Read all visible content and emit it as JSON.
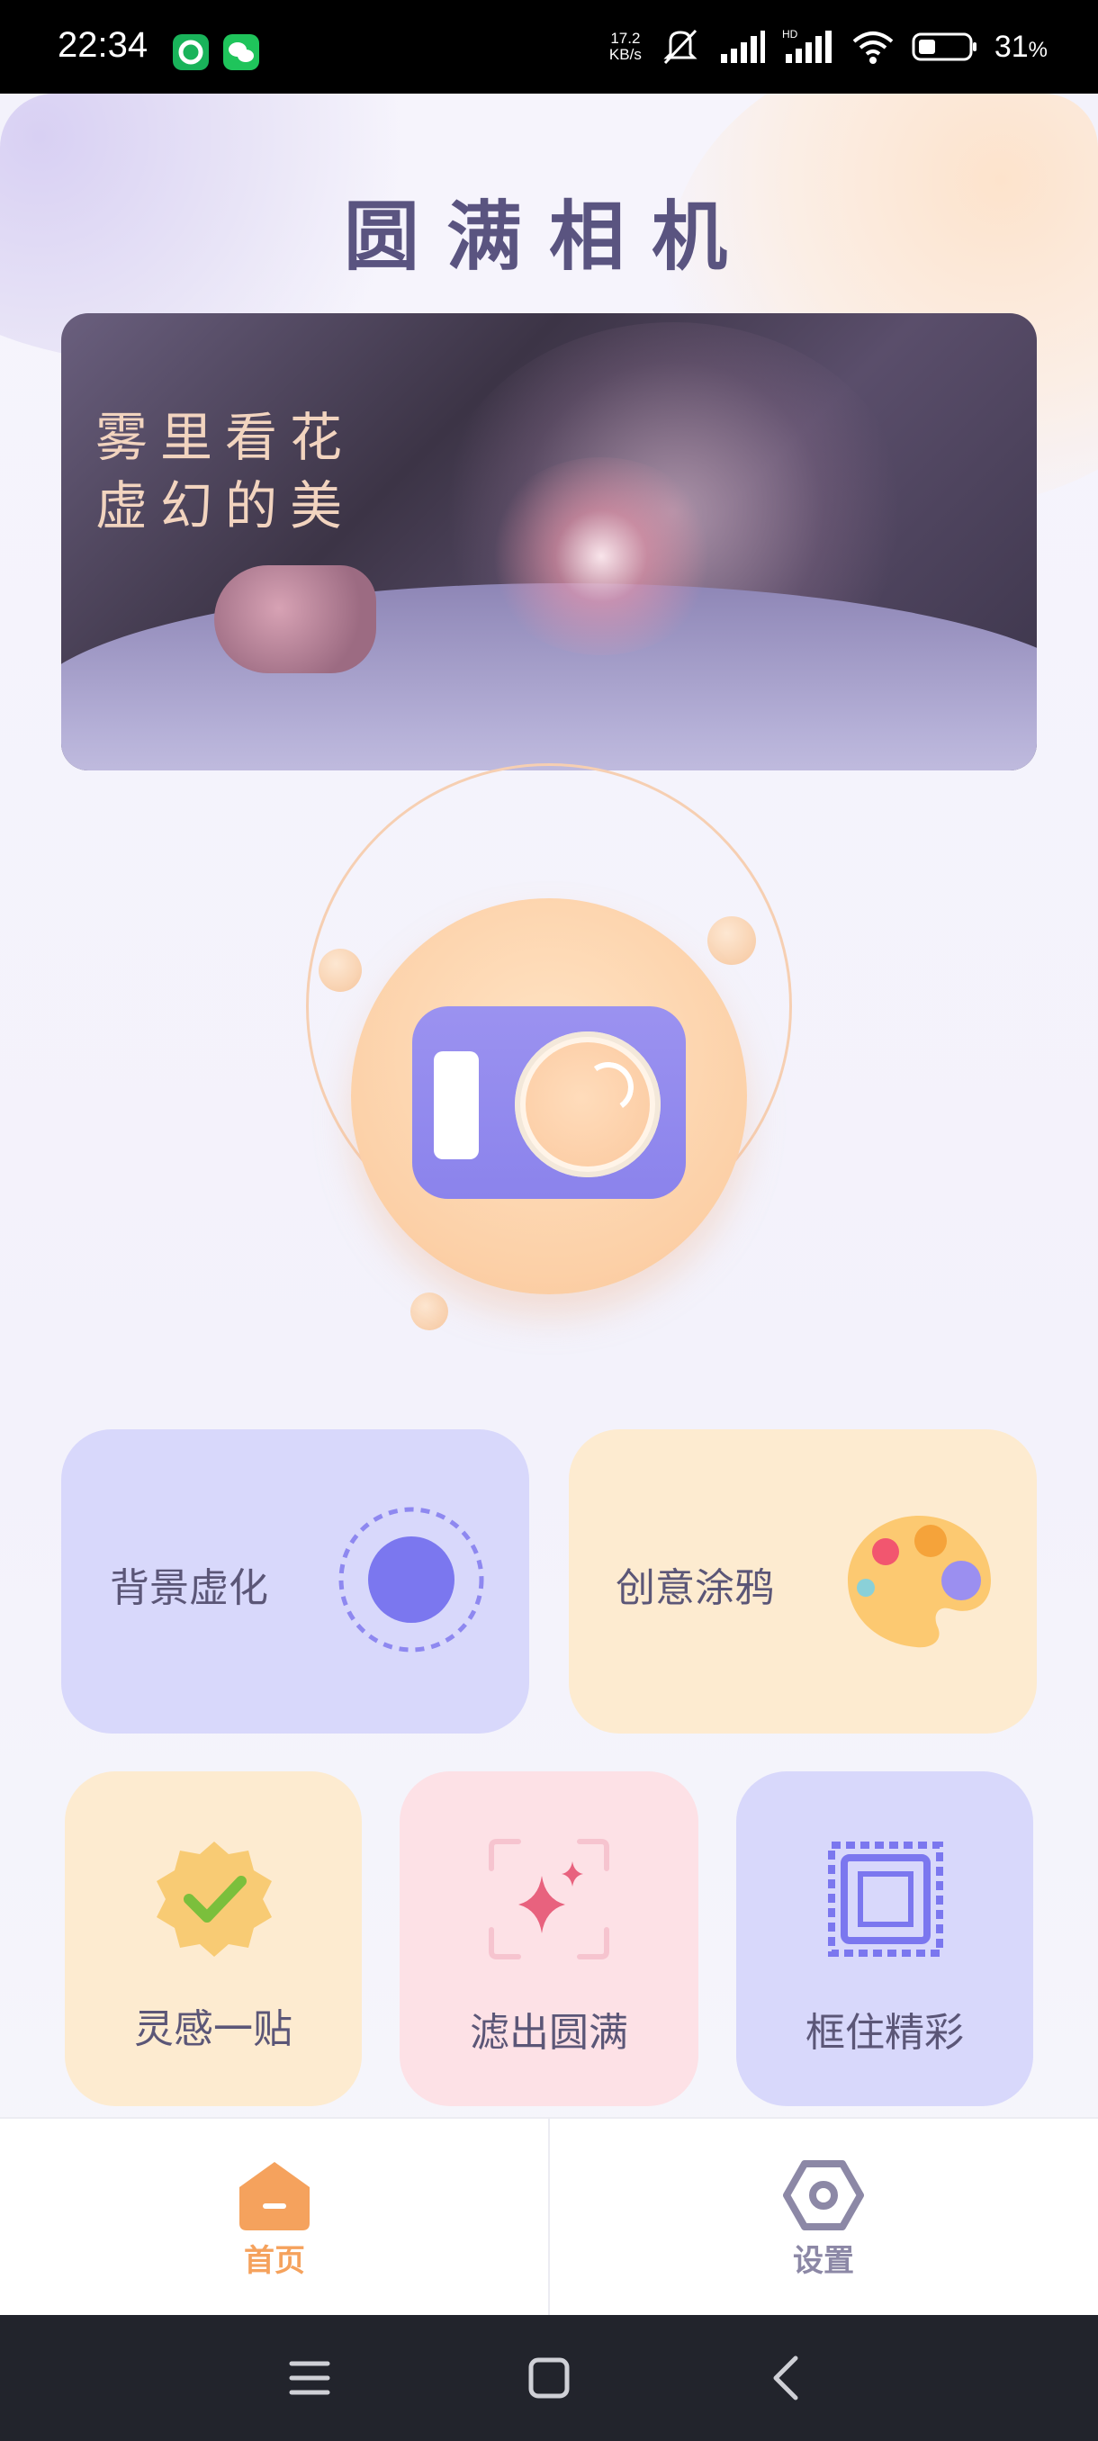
{
  "status_bar": {
    "time": "22:34",
    "net_speed_value": "17.2",
    "net_speed_unit": "KB/s",
    "battery_percent": "31",
    "battery_suffix": "%"
  },
  "app": {
    "title": "圆满相机",
    "banner": {
      "line1": "雾里看花",
      "line2": "虚幻的美"
    },
    "camera_button_icon": "camera-icon",
    "features": [
      {
        "label": "背景虚化",
        "icon": "blur-circle-icon",
        "bg": "#d8d8fb"
      },
      {
        "label": "创意涂鸦",
        "icon": "palette-icon",
        "bg": "#fdebd0"
      },
      {
        "label": "灵感一贴",
        "icon": "badge-check-icon",
        "bg": "#fdebd0"
      },
      {
        "label": "滤出圆满",
        "icon": "sparkle-icon",
        "bg": "#fde1e6"
      },
      {
        "label": "框住精彩",
        "icon": "stamp-frame-icon",
        "bg": "#d8d8fb"
      }
    ]
  },
  "bottom_nav": {
    "items": [
      {
        "label": "首页",
        "icon": "home-icon",
        "active": true,
        "color": "#f5a25d"
      },
      {
        "label": "设置",
        "icon": "settings-hex-icon",
        "active": false,
        "color": "#8c88a6"
      }
    ]
  },
  "system_nav": {
    "menu_icon": "menu-icon",
    "home_icon": "square-home-icon",
    "back_icon": "back-icon"
  },
  "colors": {
    "accent_orange": "#f5a25d",
    "accent_purple": "#8b83ec",
    "title_color": "#5a5480"
  }
}
